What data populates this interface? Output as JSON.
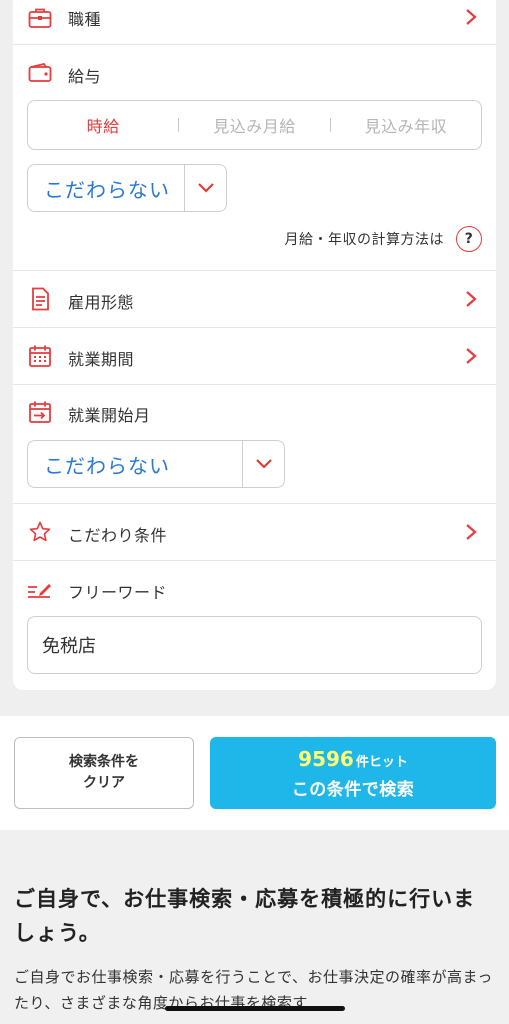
{
  "form": {
    "job_type": {
      "label": "職種"
    },
    "salary": {
      "label": "給与",
      "tabs": [
        "時給",
        "見込み月給",
        "見込み年収"
      ],
      "active_tab": "時給",
      "select_value": "こだわらない",
      "calc_link": "月給・年収の計算方法は",
      "help_symbol": "?"
    },
    "employment_type": {
      "label": "雇用形態"
    },
    "work_period": {
      "label": "就業期間"
    },
    "start_month": {
      "label": "就業開始月",
      "select_value": "こだわらない"
    },
    "preferences": {
      "label": "こだわり条件"
    },
    "freeword": {
      "label": "フリーワード",
      "value": "免税店"
    }
  },
  "actions": {
    "clear_line1": "検索条件を",
    "clear_line2": "クリア",
    "hit_count": "9596",
    "hit_suffix": "件ヒット",
    "search_label": "この条件で検索"
  },
  "info": {
    "heading": "ご自身で、お仕事検索・応募を積極的に行いましょう。",
    "body": "ご自身でお仕事検索・応募を行うことで、お仕事決定の確率が高まったり、さまざまな角度からお仕事を検索す"
  },
  "colors": {
    "accent_red": "#e83b3b",
    "link_blue": "#2a78d6",
    "search_button": "#1fb7ea",
    "hit_number": "#ffff73"
  }
}
